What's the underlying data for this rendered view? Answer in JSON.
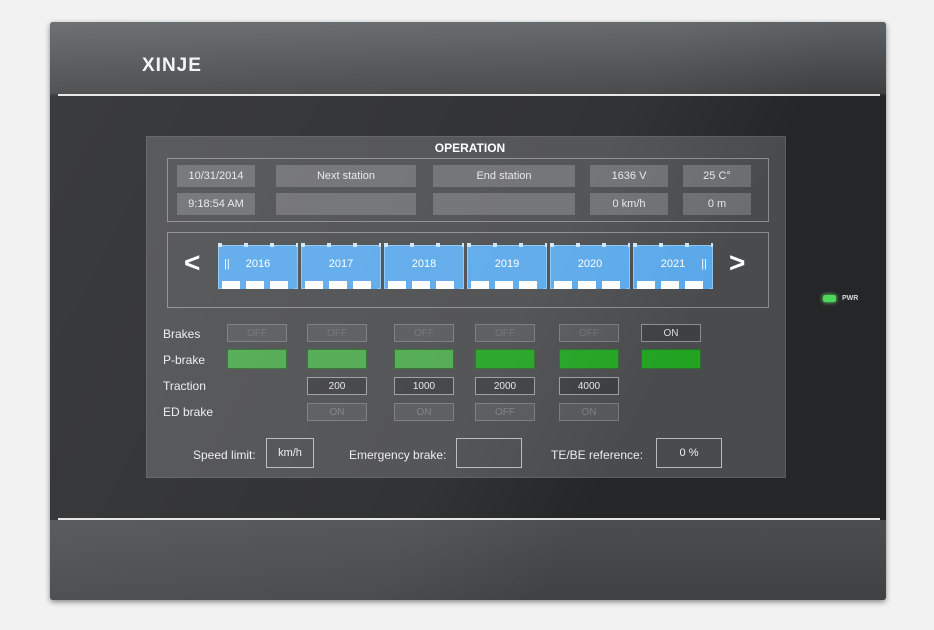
{
  "device": {
    "brand": "XINJE",
    "power_label": "PWR"
  },
  "screen": {
    "title": "OPERATION",
    "date": "10/31/2014",
    "time": "9:18:54 AM",
    "next_station_label": "Next station",
    "next_station_value": "",
    "end_station_label": "End station",
    "end_station_value": "",
    "voltage": "1636 V",
    "speed": "0 km/h",
    "temperature": "25 C°",
    "distance": "0 m",
    "nav": {
      "prev": "<",
      "next": ">"
    },
    "timeline": {
      "years": [
        "2016",
        "2017",
        "2018",
        "2019",
        "2020",
        "2021"
      ],
      "pause_marker": "||"
    },
    "rows": {
      "brakes_label": "Brakes",
      "pbrake_label": "P-brake",
      "traction_label": "Traction",
      "edbrake_label": "ED brake",
      "brakes": [
        "OFF",
        "OFF",
        "OFF",
        "OFF",
        "OFF",
        "ON"
      ],
      "traction": [
        "200",
        "1000",
        "2000",
        "4000"
      ],
      "ed_brake": [
        "ON",
        "ON",
        "OFF",
        "ON"
      ]
    },
    "bottom": {
      "speed_limit_label": "Speed limit:",
      "speed_limit_value": "km/h",
      "emergency_brake_label": "Emergency brake:",
      "emergency_brake_value": "",
      "te_be_label": "TE/BE reference:",
      "te_be_value": "0 %"
    }
  },
  "colors": {
    "accent_blue": "#5aa8ea",
    "status_green": "#22a322",
    "led_green": "#4cd85a"
  }
}
